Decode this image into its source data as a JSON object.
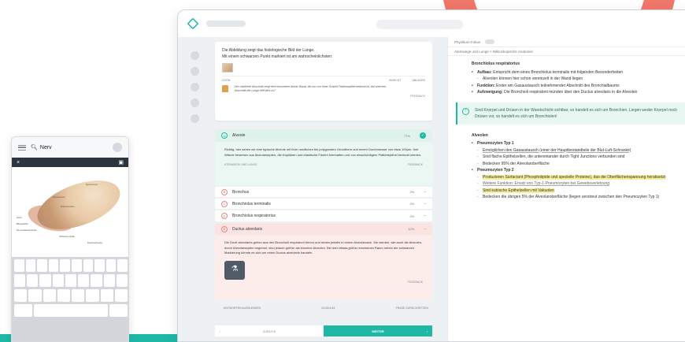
{
  "phone": {
    "search_text": "Nerv",
    "close_label": "×",
    "labels": [
      "Epineurium",
      "Perineurium",
      "Endoneurium",
      "Axon",
      "Blutgefäße",
      "Nervenfaserbündel",
      "Schwann-Zelle",
      "Myelinscheide"
    ]
  },
  "question": {
    "line1": "Die Abbildung zeigt das histologische Bild der Lunge.",
    "line2": "Mit einem schwarzen Punkt markiert ist am wahrscheinlichsten:",
    "tool_zoom": "ZOOM",
    "tool_view": "ANSICHT",
    "tool_hide": "ABLAGEN",
    "hint_line1": "Der markierte Abschnitt zeigt eine besondere dünne Wand, die nur von einer Schicht Plattenepithel bedeckt ist. Auf welchen",
    "hint_line2": "Abschnitt der Lunge trifft dies zu?",
    "feedback": "FEEDBACK"
  },
  "options": [
    {
      "letter": "A",
      "name": "Alveole",
      "pct": "77%",
      "state": "correct"
    },
    {
      "letter": "B",
      "name": "Bronchus",
      "pct": "2%",
      "state": "neutral"
    },
    {
      "letter": "C",
      "name": "Bronchiolus terminalis",
      "pct": "4%",
      "state": "neutral"
    },
    {
      "letter": "D",
      "name": "Bronchiolus respiratorius",
      "pct": "4%",
      "state": "neutral"
    },
    {
      "letter": "E",
      "name": "Ductus alveolaris",
      "pct": "12%",
      "state": "wrong"
    }
  ],
  "explanation_a": {
    "text": "Richtig, hier sehen wir eine typische Alveole mit ihrer rundlichen bis polygonalen Grundform und einem Durchmesser von etwa 100µm. Ihre Wände bestehen aus Alveolarsepten, die Kapillaren und elastische Fasern beinhalten und von einschichtigem Plattenepithel bedeckt werden.",
    "tag": "ATEMWEGE UND LUNGE",
    "feedback": "FEEDBACK"
  },
  "explanation_e": {
    "text": "Die Ducti alveolares gehen aus den Bronchioli respiratorii hervor und enden jeweils in einem Alveolarsack. Sie werden, wie auch die Alveolen, durch Alveolarsepten begrenzt, sind jedoch größer als einzelne Alveolen. Bei dem etwas größer erscheinen Raum neben der schwarzen Markierung könnte es sich um einen Ductus alveolaris handeln.",
    "feedback": "FEEDBACK"
  },
  "actions": {
    "left": "ANTWORTEN AUSBLENDEN",
    "center": "2015/11/46",
    "right": "FRAGE ZURÜCKSETZEN"
  },
  "nav": {
    "back": "ZURÜCK",
    "next": "WEITER",
    "back_arrow": "‹",
    "next_arrow": "›"
  },
  "right": {
    "toggle_label": "Physikum-Fokus",
    "breadcrumb": "Atemwege und Lunge  >  Mikroskopische Anatomie",
    "title1": "Bronchiolus respiratorius",
    "items1": [
      {
        "k": "Aufbau:",
        "v": " Entspricht dem eines Bronchiolus terminalis mit folgenden Besonderheiten"
      },
      {
        "k": "",
        "v": "Alveolen können hier schon vereinzelt in der Wand liegen"
      },
      {
        "k": "Funktion:",
        "v": " Erster am Gasaustausch teilnehmender Abschnitt des Bronchialbaums"
      },
      {
        "k": "Aufzweigung:",
        "v": " Die Bronchioli respiratorii münden über den Ductus alveolaris in die Alveolen"
      }
    ],
    "callout": "Sind Knorpel und Drüsen in der Wandschicht sichtbar, so handelt es sich um Bronchien. Liegen weder Knorpel noch Drüsen vor, so handelt es sich um Bronchiolen!",
    "title2": "Alveolen",
    "p1_title": "Pneumozyten Typ 1",
    "p1_items": [
      "Ermöglichen den Gasaustausch (einer der Hauptbestandteile der Blut-Luft-Schranke)",
      "Sind flache Epithelzellen, die untereinander durch Tight Junctions verbunden sind",
      "Bedecken 95% der Alveolaroberfläche"
    ],
    "p2_title": "Pneumozyten Typ 2",
    "p2_items": [
      "Produzieren Surfactant (Phospholipide und spezielle Proteine), das die Oberflächenspannung herabsetzt",
      "Weitere Funktion: Ersatz von Typ-1-Pneumozyten bei Gewebsverletzung",
      "Sind kubische Epithelzellen mit Vakuolen",
      "Bedecken die übrigen 5% der Alveolaroberfläche (liegen verstreut zwischen den Pneumozyten Typ 1)"
    ]
  },
  "colors": {
    "accent": "#1fb8a6",
    "coral": "#f0776a",
    "wrong_bg": "#fbe3e1",
    "correct_bg": "#dff3ec"
  }
}
